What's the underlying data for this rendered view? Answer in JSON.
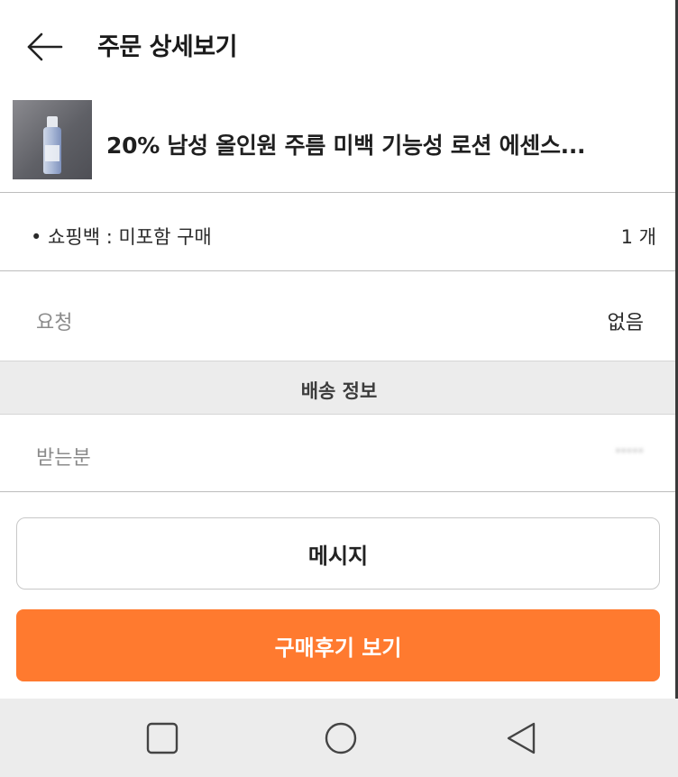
{
  "header": {
    "back_icon": "arrow-left-icon",
    "title": "주문 상세보기"
  },
  "product": {
    "name": "20% 남성 올인원 주름 미백 기능성 로션 에센스..."
  },
  "option": {
    "text": "• 쇼핑백 : 미포함 구매",
    "quantity": "1 개"
  },
  "request": {
    "label": "요청",
    "value": "없음"
  },
  "shipping": {
    "section_title": "배송 정보",
    "recipient_label": "받는분",
    "recipient_value": "·····"
  },
  "buttons": {
    "message": "메시지",
    "review": "구매후기 보기"
  },
  "colors": {
    "accent": "#ff7a2f",
    "section_bg": "#ececec",
    "divider": "#bdbdbd"
  },
  "nav": {
    "icons": [
      "square-recent-apps-icon",
      "circle-home-icon",
      "triangle-back-icon"
    ]
  }
}
